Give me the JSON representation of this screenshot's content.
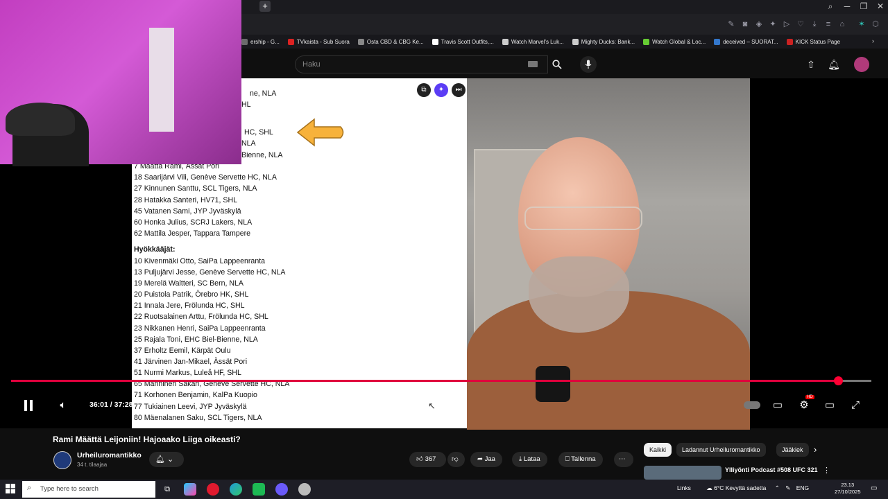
{
  "browser": {
    "bookmarks": [
      {
        "label": "ership - G...",
        "color": "#6b6b6b"
      },
      {
        "label": "TVkaista - Sub Suora",
        "color": "#d22"
      },
      {
        "label": "Osta CBD & CBG Ke...",
        "color": "#888"
      },
      {
        "label": "Travis Scott Outfits,...",
        "color": "#fff"
      },
      {
        "label": "Watch Marvel's Luk...",
        "color": "#ccc"
      },
      {
        "label": "Mighty Ducks: Bank...",
        "color": "#ccc"
      },
      {
        "label": "Watch Global & Loc...",
        "color": "#6c3"
      },
      {
        "label": "deceived – SUORAT...",
        "color": "#37c"
      },
      {
        "label": "KICK Status Page",
        "color": "#c22"
      }
    ]
  },
  "youtube": {
    "search_placeholder": "Haku",
    "video": {
      "title": "Rami Määttä Leijoniin! Hajoaako Liiga oikeasti?",
      "time": "36:01 / 37:28",
      "progress": 0.961,
      "hd_badge": "HD"
    },
    "channel": {
      "name": "Urheiluromantikko",
      "subscribers": "34 t. tilaajaa"
    },
    "actions": {
      "likes": "367",
      "share": "Jaa",
      "download": "Lataa",
      "save": "Tallenna"
    },
    "chips": [
      "Kaikki",
      "Ladannut Urheiluromantikko",
      "Jääkiek"
    ],
    "recommendation_title": "Ylliyönti Podcast #508 UFC 321"
  },
  "document": {
    "top_fragments": [
      "ne, NLA",
      "HL",
      "HC, SHL",
      "NLA",
      "Bienne, NLA"
    ],
    "defenders": [
      "7 Määttä Rami, Ässät Pori",
      "18 Saarijärvi Vili, Genève Servette HC, NLA",
      "27 Kinnunen Santtu, SCL Tigers, NLA",
      "28 Hatakka Santeri, HV71, SHL",
      "45 Vatanen Sami, JYP Jyväskylä",
      "60 Honka Julius, SCRJ Lakers, NLA",
      "62 Mattila Jesper, Tappara Tampere"
    ],
    "forwards_heading": "Hyökkääjät:",
    "forwards": [
      "10 Kivenmäki Otto, SaiPa Lappeenranta",
      "13 Puljujärvi Jesse, Genève Servette HC, NLA",
      "19 Merelä Waltteri, SC Bern, NLA",
      "20 Puistola Patrik, Örebro HK, SHL",
      "21 Innala Jere, Frölunda HC, SHL",
      "22 Ruotsalainen Arttu, Frölunda HC, SHL",
      "23 Nikkanen Henri, SaiPa Lappeenranta",
      "25 Rajala Toni, EHC Biel-Bienne, NLA",
      "37 Erholtz Eemil, Kärpät Oulu",
      "41 Järvinen Jan-Mikael, Ässät Pori",
      "51 Nurmi Markus, Luleå HF, SHL",
      "65 Manninen Sakari, Genève Servette HC, NLA",
      "71 Korhonen Benjamin, KalPa Kuopio",
      "77 Tukiainen Leevi, JYP Jyväskylä",
      "80 Mäenalanen Saku, SCL Tigers, NLA"
    ]
  },
  "taskbar": {
    "search_placeholder": "Type here to search",
    "links": "Links",
    "weather": "6°C  Kevyttä sadetta",
    "lang": "ENG",
    "time": "23.13",
    "date": "27/10/2025"
  }
}
